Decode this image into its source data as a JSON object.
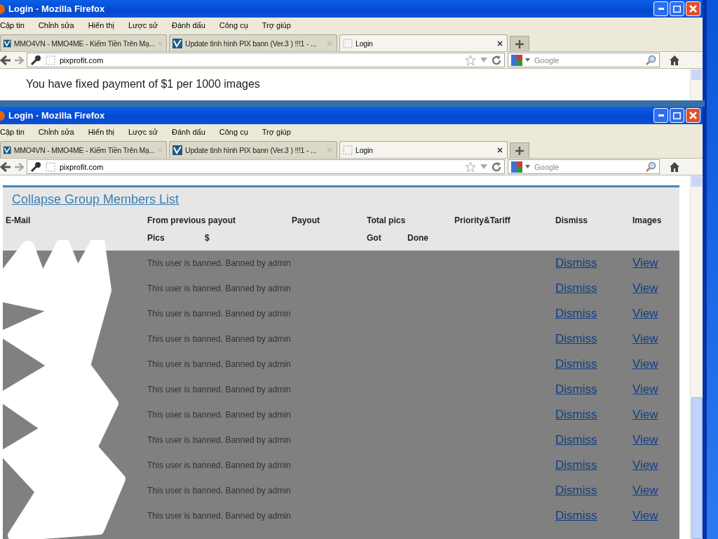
{
  "windows": [
    {
      "title": "Login - Mozilla Firefox",
      "menu": [
        "Cập tin",
        "Chỉnh sửa",
        "Hiển thị",
        "Lược sử",
        "Đánh dấu",
        "Công cụ",
        "Trợ giúp"
      ],
      "tabs": [
        {
          "label": "MMO4VN - MMO4ME - Kiếm Tiền Trên Mạ...",
          "selected": false
        },
        {
          "label": "Update tình hình PIX bann (Ver.3 ) !!!1 - ...",
          "selected": false
        },
        {
          "label": "Login",
          "selected": true
        }
      ],
      "url": "pixprofit.com",
      "search": {
        "placeholder": "Google"
      },
      "content": {
        "kind": "notice",
        "text": "You have fixed payment of $1 per 1000 images"
      }
    },
    {
      "title": "Login - Mozilla Firefox",
      "menu": [
        "Cập tin",
        "Chỉnh sửa",
        "Hiển thị",
        "Lược sử",
        "Đánh dấu",
        "Công cụ",
        "Trợ giúp"
      ],
      "tabs": [
        {
          "label": "MMO4VN - MMO4ME - Kiếm Tiền Trên Mạ...",
          "selected": false
        },
        {
          "label": "Update tình hình PIX bann (Ver.3 ) !!!1 - ...",
          "selected": false
        },
        {
          "label": "Login",
          "selected": true
        }
      ],
      "url": "pixprofit.com",
      "search": {
        "placeholder": "Google"
      },
      "content": {
        "kind": "members",
        "link": "Collapse Group Members List",
        "columns": [
          "E-Mail",
          "From previous payout",
          "Payout",
          "Total pics",
          "Priority&Tariff",
          "Dismiss",
          "Images"
        ],
        "subcolumns": [
          "Pics",
          "$",
          "Got",
          "Done"
        ],
        "rows": [
          {
            "status": "This user is banned. Banned by admin",
            "dismiss": "Dismiss",
            "images": "View"
          },
          {
            "status": "This user is banned. Banned by admin",
            "dismiss": "Dismiss",
            "images": "View"
          },
          {
            "status": "This user is banned. Banned by admin",
            "dismiss": "Dismiss",
            "images": "View"
          },
          {
            "status": "This user is banned. Banned by admin",
            "dismiss": "Dismiss",
            "images": "View"
          },
          {
            "status": "This user is banned. Banned by admin",
            "dismiss": "Dismiss",
            "images": "View"
          },
          {
            "status": "This user is banned. Banned by admin",
            "dismiss": "Dismiss",
            "images": "View"
          },
          {
            "status": "This user is banned. Banned by admin",
            "dismiss": "Dismiss",
            "images": "View"
          },
          {
            "status": "This user is banned. Banned by admin",
            "dismiss": "Dismiss",
            "images": "View"
          },
          {
            "status": "This user is banned. Banned by admin",
            "dismiss": "Dismiss",
            "images": "View"
          },
          {
            "status": "This user is banned. Banned by admin",
            "dismiss": "Dismiss",
            "images": "View"
          },
          {
            "status": "This user is banned. Banned by admin",
            "dismiss": "Dismiss",
            "images": "View"
          }
        ]
      }
    }
  ]
}
